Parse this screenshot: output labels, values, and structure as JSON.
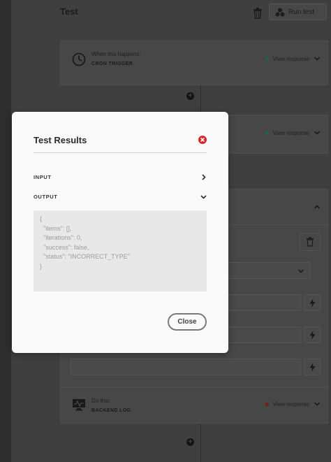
{
  "page": {
    "title": "Test",
    "run_test_label": "Run test"
  },
  "steps": [
    {
      "label": "When this happens:",
      "name": "CRON TRIGGER",
      "view_response": "View response",
      "status_color": "#0f6f3f"
    },
    {
      "view_response": "View response",
      "status_color": "#0f6f3f"
    },
    {},
    {
      "label": "Do this:",
      "name": "BACKEND LOG",
      "view_response": "View response",
      "status_color": "#7a1a1a"
    }
  ],
  "modal": {
    "title": "Test Results",
    "sections": [
      {
        "label": "INPUT",
        "expanded": false
      },
      {
        "label": "OUTPUT",
        "expanded": true
      }
    ],
    "output_lines": [
      "{",
      "  \"items\": [],",
      "  \"iterations\": 0,",
      "  \"success\": false,",
      "  \"status\": \"INCORRECT_TYPE\"",
      "}"
    ],
    "close_label": "Close",
    "close_icon_color": "#d42a2a"
  }
}
